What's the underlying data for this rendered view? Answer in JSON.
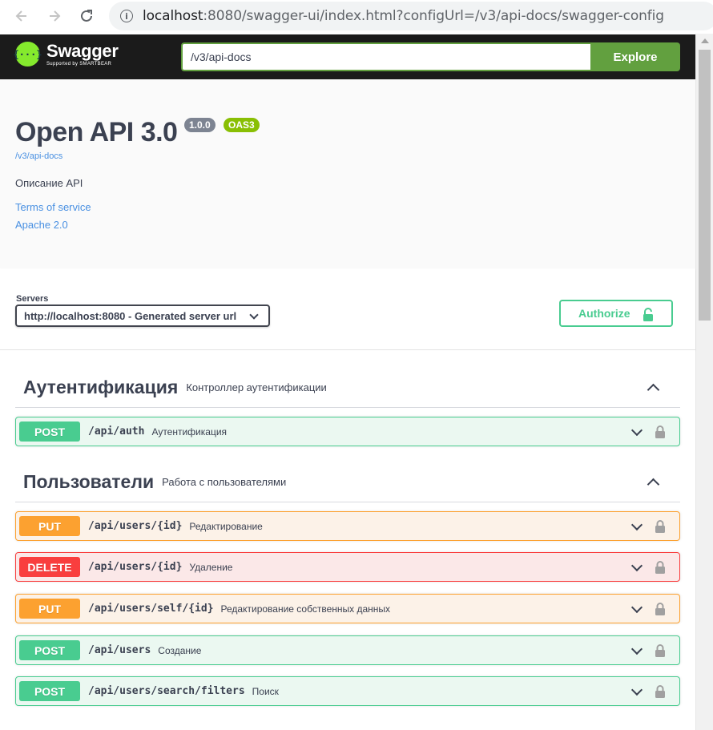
{
  "browser": {
    "url_host": "localhost",
    "url_rest": ":8080/swagger-ui/index.html?configUrl=/v3/api-docs/swagger-config"
  },
  "topbar": {
    "logo_name": "Swagger",
    "logo_sub": "Supported by SMARTBEAR",
    "logo_mark": "{···}",
    "input_value": "/v3/api-docs",
    "explore_label": "Explore"
  },
  "info": {
    "title": "Open API 3.0",
    "version": "1.0.0",
    "oas": "OAS3",
    "url": "/v3/api-docs",
    "description": "Описание API",
    "terms": "Terms of service",
    "license": "Apache 2.0"
  },
  "servers": {
    "label": "Servers",
    "selected": "http://localhost:8080 - Generated server url",
    "authorize_label": "Authorize"
  },
  "tags": [
    {
      "name": "Аутентификация",
      "description": "Контроллер аутентификации",
      "operations": [
        {
          "method": "POST",
          "path": "/api/auth",
          "summary": "Аутентификация"
        }
      ]
    },
    {
      "name": "Пользователи",
      "description": "Работа с пользователями",
      "operations": [
        {
          "method": "PUT",
          "path": "/api/users/{id}",
          "summary": "Редактирование"
        },
        {
          "method": "DELETE",
          "path": "/api/users/{id}",
          "summary": "Удаление"
        },
        {
          "method": "PUT",
          "path": "/api/users/self/{id}",
          "summary": "Редактирование собственных данных"
        },
        {
          "method": "POST",
          "path": "/api/users",
          "summary": "Создание"
        },
        {
          "method": "POST",
          "path": "/api/users/search/filters",
          "summary": "Поиск"
        }
      ]
    }
  ],
  "colors": {
    "post": "#49cc90",
    "put": "#fca130",
    "delete": "#f93e3e",
    "topbar": "#1b1b1b",
    "explore": "#62a03f"
  }
}
